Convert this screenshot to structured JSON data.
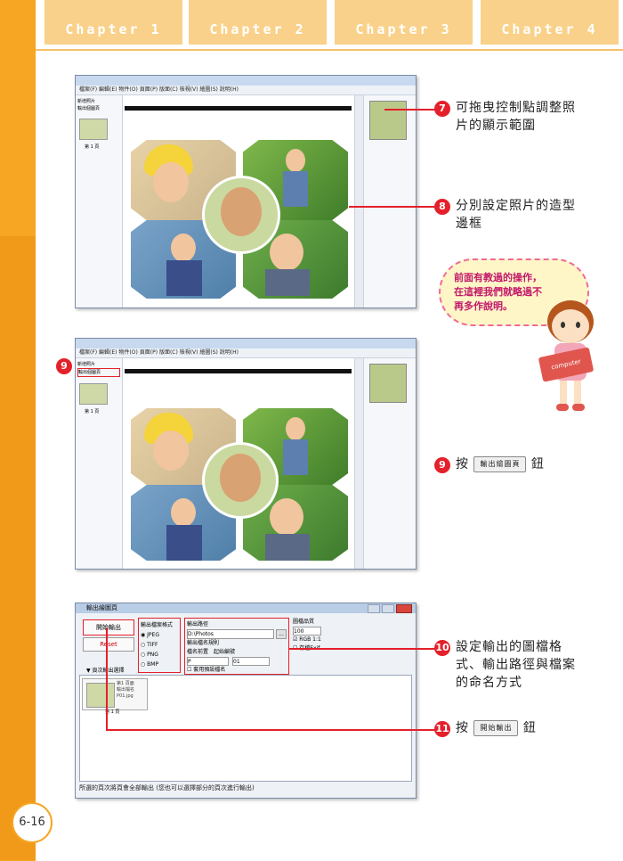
{
  "header": {
    "tabs": [
      "Chapter 1",
      "Chapter 2",
      "Chapter 3",
      "Chapter 4"
    ]
  },
  "screenshot1": {
    "menu": "檔案(F)  編輯(E)  物件(O)  頁面(P)  版面(C)  檢視(V)  繪圖(S)  說明(H)",
    "sidebar_items": [
      "新增照片",
      "輸出個圖頁"
    ],
    "thumb_label": "第 1 頁"
  },
  "screenshot2": {
    "menu": "檔案(F)  編輯(E)  物件(O)  頁面(P)  版面(C)  檢視(V)  繪圖(S)  說明(H)",
    "sidebar_items": [
      "新增照片",
      "輸出個圖頁"
    ],
    "thumb_label": "第 1 頁"
  },
  "dialog": {
    "title": "輸出繪圖頁",
    "start_button": "開始輸出",
    "reset_button": "Reset",
    "format_group": "輸出檔案格式",
    "formats": [
      "JPEG",
      "TIFF",
      "PNG",
      "BMP"
    ],
    "path_label": "輸出路徑",
    "path_value": "D:\\Photos",
    "browse": "...",
    "naming_label": "輸出檔名規則",
    "naming_fields": [
      "檔名前置",
      "起始編號"
    ],
    "name_prefix": "P",
    "start_number": "01",
    "auto_name": "套用預設檔名",
    "size_label": "圖檔品質",
    "size_value": "100",
    "ratio_check": "RGB 1:1",
    "save_check": "存檔Exif",
    "list_header": "▼ 頁次輸出選擇",
    "thumb_lines": [
      "第1 頁面",
      "輸出檔名",
      "P01.jpg"
    ],
    "thumb_label": "第 1 頁",
    "status": "所選的頁次將頁會全部輸出 (您也可以選擇部分的頁次進行輸出)"
  },
  "callouts": [
    {
      "num": "7",
      "text": "可拖曳控制點調整照片的顯示範圍"
    },
    {
      "num": "8",
      "text": "分別設定照片的造型邊框"
    },
    {
      "num": "9",
      "pre": "按",
      "button": "輸出繪圖頁",
      "post": "鈕"
    },
    {
      "num": "10",
      "text": "設定輸出的圖檔格式、輸出路徑與檔案的命名方式"
    },
    {
      "num": "11",
      "pre": "按",
      "button": "開始輸出",
      "post": "鈕"
    }
  ],
  "marker_9": "9",
  "bubble": {
    "lines": [
      "前面有教過的操作，",
      "在這裡我們就略過不",
      "再多作說明。"
    ]
  },
  "mascot_book": "computer",
  "page_number": "6-16",
  "colors": {
    "accent_orange": "#f6a623",
    "callout_red": "#e4202a",
    "bubble_pink": "#f06a9a"
  }
}
